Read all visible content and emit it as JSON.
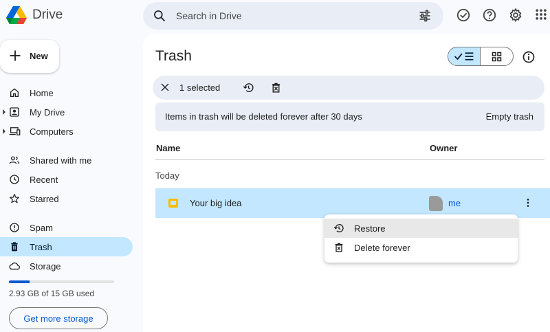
{
  "app": {
    "name": "Drive"
  },
  "search": {
    "placeholder": "Search in Drive"
  },
  "sidebar": {
    "new_label": "New",
    "items": [
      {
        "label": "Home"
      },
      {
        "label": "My Drive"
      },
      {
        "label": "Computers"
      },
      {
        "label": "Shared with me"
      },
      {
        "label": "Recent"
      },
      {
        "label": "Starred"
      },
      {
        "label": "Spam"
      },
      {
        "label": "Trash"
      },
      {
        "label": "Storage"
      }
    ],
    "active_item": "Trash",
    "storage": {
      "text": "2.93 GB of 15 GB used",
      "used_fraction": 0.195
    },
    "get_storage_label": "Get more storage"
  },
  "main": {
    "title": "Trash",
    "selection": {
      "count_label": "1 selected"
    },
    "banner": {
      "message": "Items in trash will be deleted forever after 30 days",
      "action": "Empty trash"
    },
    "columns": {
      "name": "Name",
      "owner": "Owner"
    },
    "section": "Today",
    "files": [
      {
        "name": "Your big idea",
        "owner": "me",
        "icon": "slides-icon"
      }
    ]
  },
  "context_menu": {
    "items": [
      {
        "label": "Restore",
        "icon": "restore-icon"
      },
      {
        "label": "Delete forever",
        "icon": "delete-forever-icon"
      }
    ]
  },
  "colors": {
    "accent": "#0b57d0",
    "selected": "#c2e7ff",
    "surface": "#e9eef6",
    "background": "#f8fafd"
  }
}
